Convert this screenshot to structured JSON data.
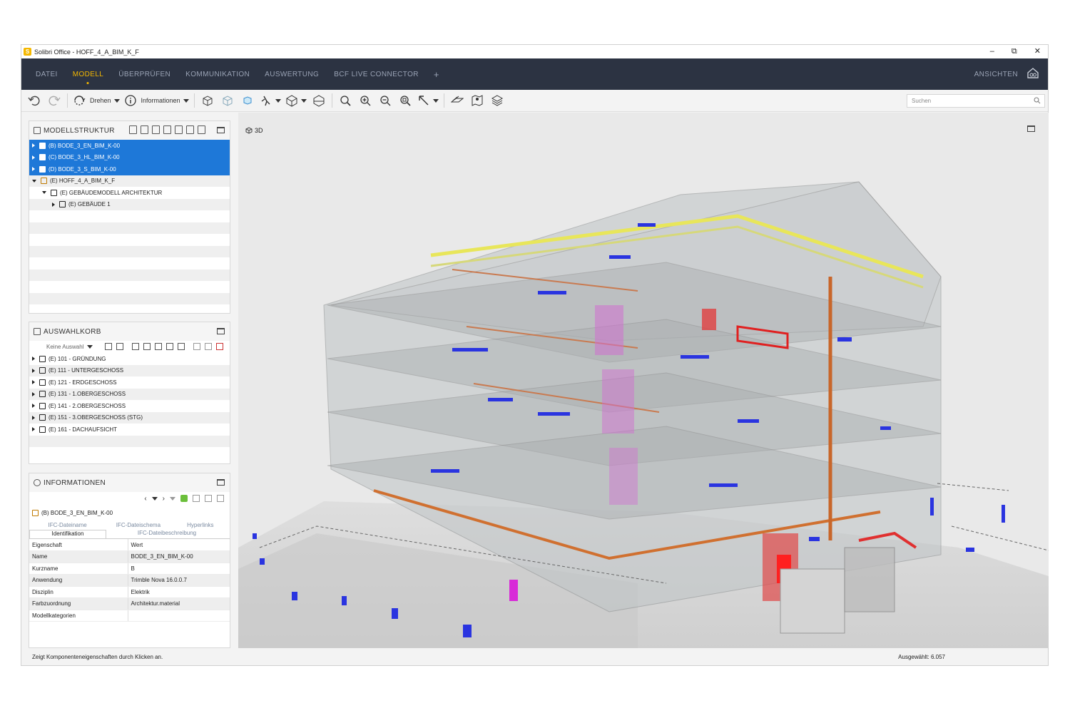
{
  "window": {
    "title": "Solibri Office - HOFF_4_A_BIM_K_F",
    "controls": [
      "–",
      "⧉",
      "✕"
    ]
  },
  "menu": {
    "items": [
      "DATEI",
      "MODELL",
      "ÜBERPRÜFEN",
      "KOMMUNIKATION",
      "AUSWERTUNG",
      "BCF LIVE CONNECTOR"
    ],
    "active": "MODELL",
    "plus": "+",
    "right_label": "ANSICHTEN"
  },
  "toolbar": {
    "rotate_label": "Drehen",
    "info_label": "Informationen",
    "search_placeholder": "Suchen"
  },
  "model_structure": {
    "title": "MODELLSTRUKTUR",
    "rows": [
      {
        "label": "(B) BODE_3_EN_BIM_K-00",
        "selected": true
      },
      {
        "label": "(C) BODE_3_HL_BIM_K-00",
        "selected": true
      },
      {
        "label": "(D) BODE_3_S_BIM_K-00",
        "selected": true
      },
      {
        "label": "(E) HOFF_4_A_BIM_K_F",
        "selected": false
      },
      {
        "label": "(E) GEBÄUDEMODELL ARCHITEKTUR",
        "selected": false
      },
      {
        "label": "(E) GEBÄUDE 1",
        "selected": false
      }
    ]
  },
  "selection_basket": {
    "title": "AUSWAHLKORB",
    "dropdown": "Keine Auswahl",
    "rows": [
      "(E) 101 - GRÜNDUNG",
      "(E) 111 - UNTERGESCHOSS",
      "(E) 121 - ERDGESCHOSS",
      "(E) 131 - 1.OBERGESCHOSS",
      "(E) 141 - 2.OBERGESCHOSS",
      "(E) 151 - 3.OBERGESCHOSS (STG)",
      "(E) 161 - DACHAUFSICHT"
    ]
  },
  "information": {
    "title": "INFORMATIONEN",
    "model": "(B) BODE_3_EN_BIM_K-00",
    "tabs_top": [
      "IFC-Dateiname",
      "IFC-Dateischema",
      "Hyperlinks"
    ],
    "tabs_bottom": [
      "Identifikation",
      "IFC-Dateibeschreibung"
    ],
    "header": [
      "Eigenschaft",
      "Wert"
    ],
    "rows": [
      [
        "Name",
        "BODE_3_EN_BIM_K-00"
      ],
      [
        "Kurzname",
        "B"
      ],
      [
        "Anwendung",
        "Trimble Nova 16.0.0.7"
      ],
      [
        "Disziplin",
        "Elektrik"
      ],
      [
        "Farbzuordnung",
        "Architektur.material"
      ],
      [
        "Modellkategorien",
        ""
      ]
    ]
  },
  "viewport": {
    "label": "3D"
  },
  "status": {
    "hint": "Zeigt Komponenteneigenschaften durch Klicken an.",
    "selected": "Ausgewählt: 6.057"
  },
  "colors": {
    "menubar": "#2c3342",
    "accent": "#f5b800",
    "selection": "#1e78d8"
  }
}
